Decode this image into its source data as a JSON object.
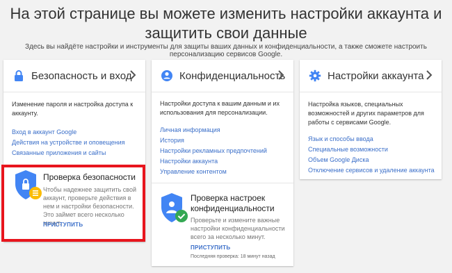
{
  "header": {
    "title": "На этой странице вы можете изменить настройки аккаунта и защитить свои данные",
    "subtitle": "Здесь вы найдёте настройки и инструменты для защиты ваших данных и конфиденциальности, а также сможете настроить персонализацию сервисов Google."
  },
  "cards": {
    "security": {
      "title": "Безопасность и вход",
      "icon": "lock-icon",
      "description": "Изменение пароля и настройка доступа к аккаунту.",
      "links": [
        "Вход в аккаунт Google",
        "Действия на устройстве и оповещения",
        "Связанные приложения и сайты"
      ],
      "checkup": {
        "title": "Проверка безопасности",
        "description": "Чтобы надежнее защитить свой аккаунт, проверьте действия в нем и настройки безопасности. Это займет всего несколько минут.",
        "action": "ПРИСТУПИТЬ"
      }
    },
    "privacy": {
      "title": "Конфиденциальность",
      "icon": "person-icon",
      "description": "Настройки доступа к вашим данным и их использования для персонализации.",
      "links": [
        "Личная информация",
        "История",
        "Настройки рекламных предпочтений",
        "Настройки аккаунта",
        "Управление контентом"
      ],
      "checkup": {
        "title": "Проверка настроек конфиденциальности",
        "description": "Проверьте и измените важные настройки конфиденциальности всего за несколько минут.",
        "action": "ПРИСТУПИТЬ",
        "last_check": "Последняя проверка: 18 минут назад"
      }
    },
    "account": {
      "title": "Настройки аккаунта",
      "icon": "gear-icon",
      "description": "Настройка языков, специальных возможностей и других параметров для работы с сервисами Google.",
      "links": [
        "Язык и способы ввода",
        "Специальные возможности",
        "Объем Google Диска",
        "Отключение сервисов и удаление аккаунта"
      ]
    }
  },
  "colors": {
    "link": "#3b6fc9",
    "shield_blue": "#4285f4",
    "badge_yellow": "#fbbc05",
    "badge_green": "#34a853",
    "highlight": "#e8151d"
  }
}
